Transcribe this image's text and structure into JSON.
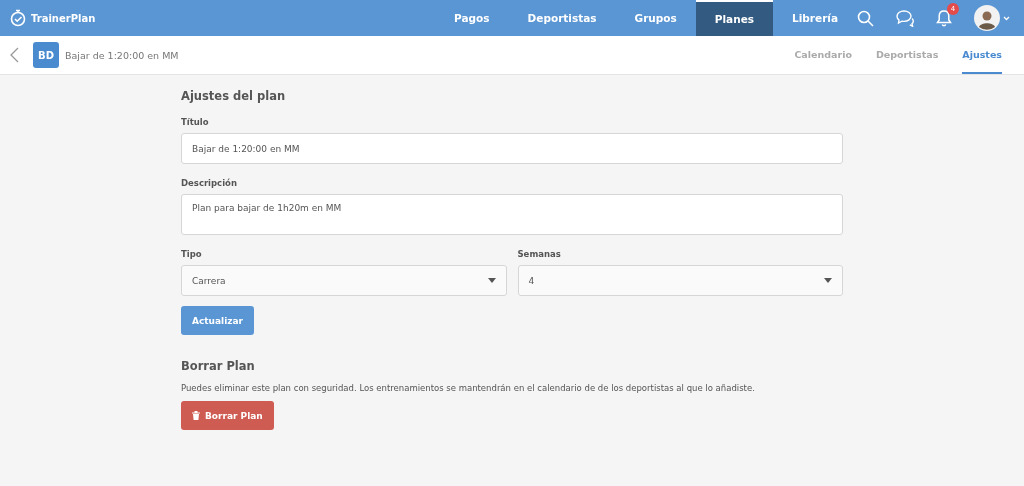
{
  "app": {
    "name": "TrainerPlan"
  },
  "nav": [
    {
      "label": "Pagos",
      "selected": false
    },
    {
      "label": "Deportistas",
      "selected": false
    },
    {
      "label": "Grupos",
      "selected": false
    },
    {
      "label": "Planes",
      "selected": true
    },
    {
      "label": "Librería",
      "selected": false
    }
  ],
  "notifications": {
    "count": "4"
  },
  "plan_header": {
    "initials": "BD",
    "title": "Bajar de 1:20:00 en MM"
  },
  "subtabs": [
    {
      "label": "Calendario",
      "selected": false
    },
    {
      "label": "Deportistas",
      "selected": false
    },
    {
      "label": "Ajustes",
      "selected": true
    }
  ],
  "settings": {
    "heading": "Ajustes del plan",
    "title_field": {
      "label": "Título",
      "value": "Bajar de 1:20:00 en MM"
    },
    "description_field": {
      "label": "Descripción",
      "value": "Plan para bajar de 1h20m en MM"
    },
    "type_field": {
      "label": "Tipo",
      "value": "Carrera"
    },
    "weeks_field": {
      "label": "Semanas",
      "value": "4"
    },
    "update_button": "Actualizar"
  },
  "delete": {
    "heading": "Borrar Plan",
    "text": "Puedes eliminar este plan con seguridad. Los entrenamientos se mantendrán en el calendario de de los deportistas al que lo añadiste.",
    "button": "Borrar Plan"
  }
}
